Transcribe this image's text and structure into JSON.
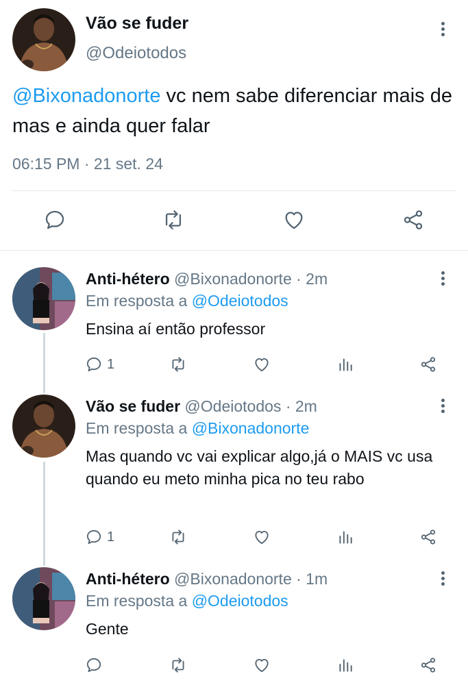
{
  "main_tweet": {
    "display_name": "Vão se fuder",
    "handle": "@Odeiotodos",
    "mention": "@Bixonadonorte",
    "text": " vc nem sabe diferenciar mais de mas e ainda quer falar",
    "time": "06:15 PM",
    "separator": " · ",
    "date": "21 set. 24"
  },
  "replies": [
    {
      "display_name": "Anti-hétero",
      "meta": " @Bixonadonorte · 2m",
      "in_reply_prefix": "Em resposta a ",
      "in_reply_handle": "@Odeiotodos",
      "text": "Ensina aí então professor",
      "reply_count": "1"
    },
    {
      "display_name": "Vão se fuder",
      "meta": " @Odeiotodos · 2m",
      "in_reply_prefix": "Em resposta a ",
      "in_reply_handle": "@Bixonadonorte",
      "text": "Mas quando vc vai explicar algo,já o MAIS vc usa quando eu meto minha pica no teu rabo",
      "reply_count": "1"
    },
    {
      "display_name": "Anti-hétero",
      "meta": " @Bixonadonorte · 1m",
      "in_reply_prefix": "Em resposta a ",
      "in_reply_handle": "@Odeiotodos",
      "text": "Gente",
      "reply_count": ""
    }
  ],
  "icons": {
    "reply": "reply-icon",
    "retweet": "retweet-icon",
    "like": "heart-icon",
    "analytics": "analytics-icon",
    "share": "share-icon",
    "more": "more-options-icon"
  },
  "colors": {
    "link": "#1d9bf0",
    "secondary_text": "#657786",
    "icon": "#536471",
    "divider": "#e1e8ed"
  }
}
